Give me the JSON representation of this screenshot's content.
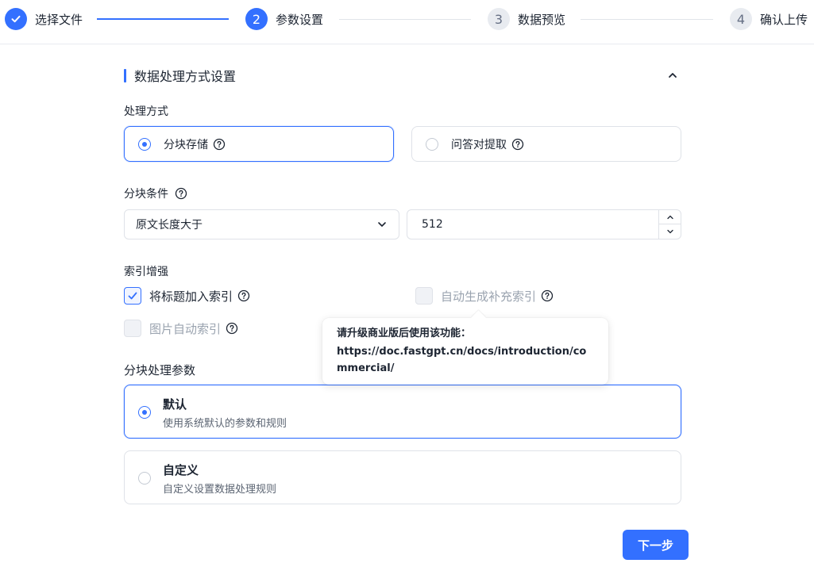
{
  "stepper": {
    "steps": [
      {
        "index": "1",
        "label": "选择文件",
        "status": "done"
      },
      {
        "index": "2",
        "label": "参数设置",
        "status": "active"
      },
      {
        "index": "3",
        "label": "数据预览",
        "status": "todo"
      },
      {
        "index": "4",
        "label": "确认上传",
        "status": "todo"
      }
    ]
  },
  "section": {
    "title": "数据处理方式设置",
    "collapse_icon": "chevron-up-icon"
  },
  "processing": {
    "label": "处理方式",
    "options": [
      {
        "label": "分块存储",
        "selected": true
      },
      {
        "label": "问答对提取",
        "selected": false
      }
    ]
  },
  "chunk_condition": {
    "label": "分块条件",
    "select_value": "原文长度大于",
    "number_value": "512"
  },
  "index_enhance": {
    "label": "索引增强",
    "options": [
      {
        "label": "将标题加入索引",
        "checked": true,
        "disabled": false
      },
      {
        "label": "自动生成补充索引",
        "checked": false,
        "disabled": true
      },
      {
        "label": "图片自动索引",
        "checked": false,
        "disabled": true
      }
    ]
  },
  "tooltip": {
    "line1": "请升级商业版后使用该功能：",
    "line2": "https://doc.fastgpt.cn/docs/introduction/commercial/"
  },
  "chunk_params": {
    "label": "分块处理参数",
    "options": [
      {
        "title": "默认",
        "desc": "使用系统默认的参数和规则",
        "selected": true
      },
      {
        "title": "自定义",
        "desc": "自定义设置数据处理规则",
        "selected": false
      }
    ]
  },
  "footer": {
    "next_label": "下一步"
  },
  "colors": {
    "accent": "#3370ff",
    "border": "#dfe2e8"
  }
}
